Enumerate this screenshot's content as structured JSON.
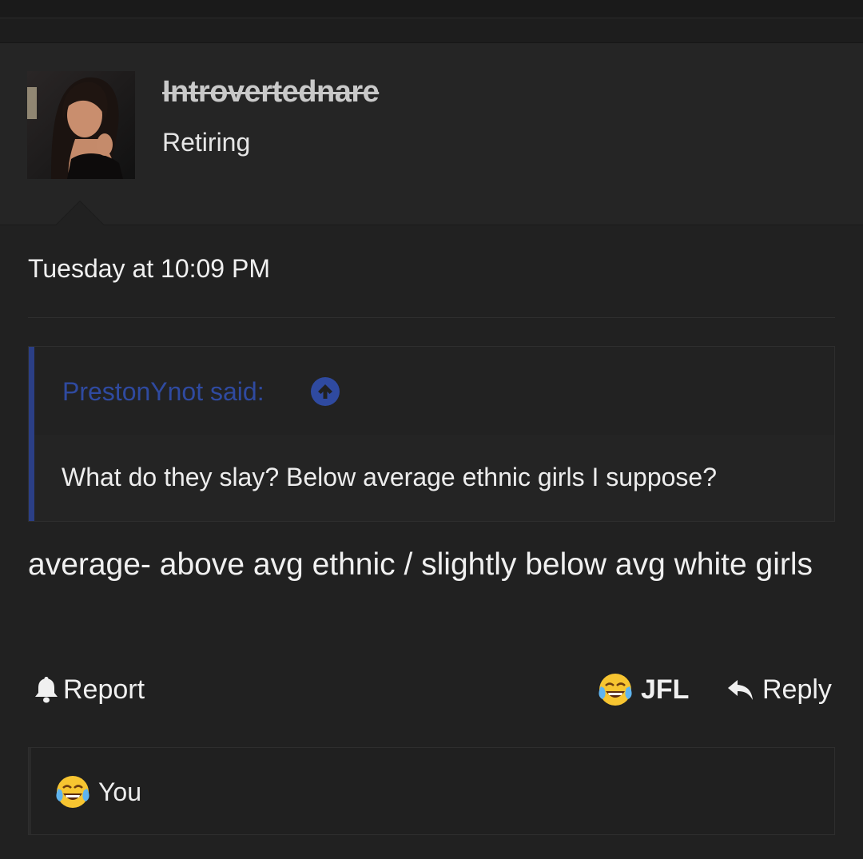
{
  "post": {
    "username": "Introvertednare",
    "user_title": "Retiring",
    "date": "Tuesday at 10:09 PM",
    "quote": {
      "author": "PrestonYnot said:",
      "body": "What do they slay? Below average ethnic girls I suppose?"
    },
    "message": "average- above avg ethnic / slightly below avg white girls"
  },
  "actions": {
    "report_label": "Report",
    "reaction_label": "JFL",
    "reply_label": "Reply"
  },
  "reactions": {
    "summary": "You"
  },
  "icons": {
    "report": "bell-icon",
    "reaction": "joy-tears-emoji",
    "reply": "reply-arrow-icon",
    "quote_jump": "arrow-up-circle-icon"
  },
  "colors": {
    "background": "#212121",
    "user_block": "#252525",
    "quote_accent": "#2b3f86",
    "quote_author": "#2f4aa0"
  }
}
